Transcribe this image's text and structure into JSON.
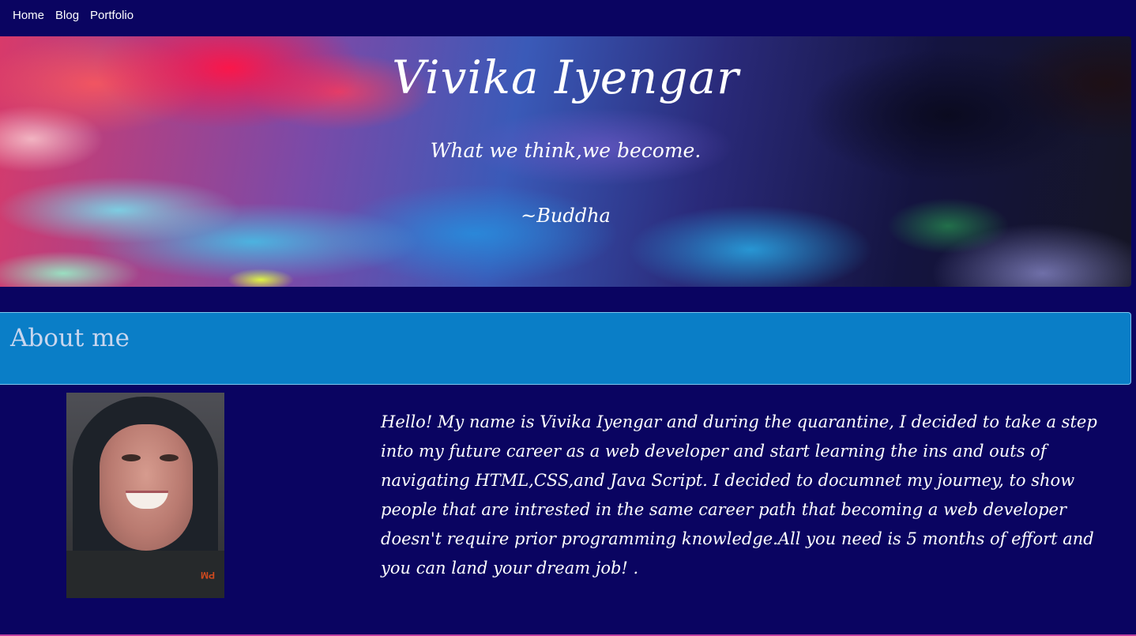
{
  "nav": {
    "items": [
      {
        "label": "Home"
      },
      {
        "label": "Blog"
      },
      {
        "label": "Portfolio"
      }
    ]
  },
  "hero": {
    "title": "Vivika Iyengar",
    "quote": "What we think,we become.",
    "author": "~Buddha"
  },
  "about": {
    "title": "About me",
    "photo_stamp": "PM",
    "bio": "Hello! My name is Vivika Iyengar and during the quarantine, I decided to take a step into my future career as a web developer and start learning the ins and outs of navigating HTML,CSS,and Java Script. I decided to documnet my journey, to show people that are intrested in the same career path that becoming a web developer doesn't require prior programming knowledge.All you need is 5 months of effort and you can land your dream job! ."
  },
  "colors": {
    "page_background": "#0a0461",
    "about_header_background": "#0a7ec7",
    "about_header_text": "#c8d6ee",
    "text": "#ffffff"
  }
}
